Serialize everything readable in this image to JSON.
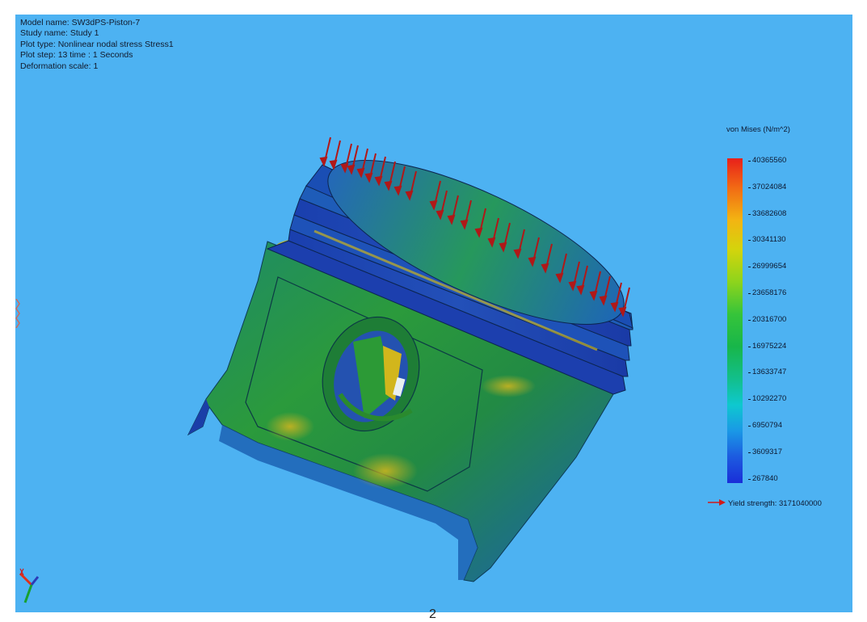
{
  "study_info": {
    "model_name": "Model name: SW3dPS-Piston-7",
    "study_name": "Study name: Study 1",
    "plot_type": "Plot type: Nonlinear nodal stress Stress1",
    "plot_step": "Plot step: 13   time : 1 Seconds",
    "deformation_scale": "Deformation scale: 1"
  },
  "legend": {
    "title": "von Mises (N/m^2)",
    "ticks": [
      "40365560",
      "37024084",
      "33682608",
      "30341130",
      "26999654",
      "23658176",
      "20316700",
      "16975224",
      "13633747",
      "10292270",
      "6950794",
      "3609317",
      "267840"
    ],
    "colormap": [
      "#e8201a",
      "#f3b412",
      "#36c43a",
      "#0ec8cf",
      "#1a2ed8"
    ]
  },
  "yield_strength": "Yield strength: 3171040000",
  "footer_mark": "2",
  "colors": {
    "background": "#4db2f2",
    "load_arrow": "#b01818"
  }
}
